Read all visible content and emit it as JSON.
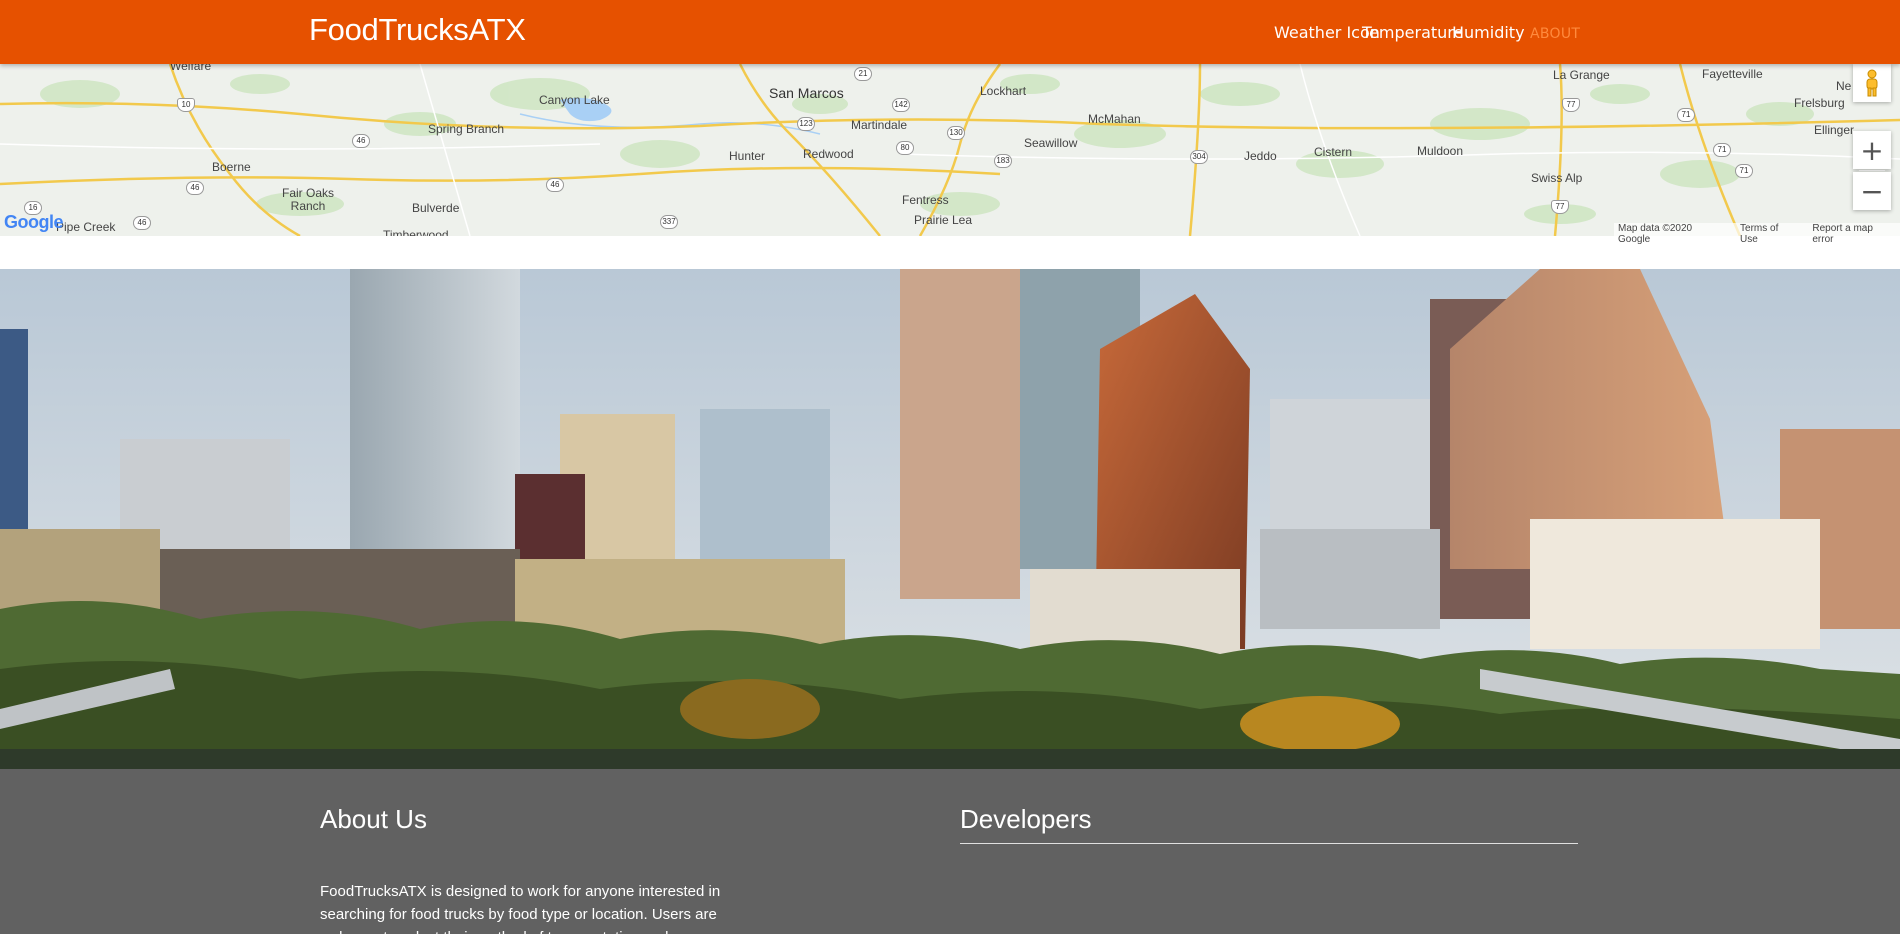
{
  "navbar": {
    "brand": "FoodTrucksATX",
    "weather_icon_alt": "Weather Icon",
    "temperature_label": "Temperature",
    "humidity_label": "Humidity",
    "about_link": "ABOUT"
  },
  "map": {
    "places": [
      "Welfare",
      "Canyon Lake",
      "San Marcos",
      "Lockhart",
      "La Grange",
      "Fayetteville",
      "Ne",
      "Frelsburg",
      "Spring Branch",
      "Martindale",
      "McMahan",
      "Boerne",
      "Hunter",
      "Redwood",
      "Seawillow",
      "Jeddo",
      "Cistern",
      "Muldoon",
      "Ellinger",
      "Fair Oaks Ranch",
      "Swiss Alp",
      "Bulverde",
      "Fentress",
      "Prairie Lea",
      "Pipe Creek",
      "Timberwood"
    ],
    "shields": [
      "21",
      "10",
      "142",
      "123",
      "130",
      "77",
      "71",
      "46",
      "80",
      "183",
      "304",
      "71",
      "46",
      "46",
      "71",
      "16",
      "46",
      "337",
      "77"
    ],
    "logo": "Google",
    "footer": {
      "map_data": "Map data ©2020 Google",
      "terms": "Terms of Use",
      "report": "Report a map error"
    },
    "zoom_in": "+",
    "zoom_out": "−"
  },
  "hero": {
    "scene": "Austin city skyline"
  },
  "footer": {
    "about_title": "About Us",
    "developers_title": "Developers",
    "about_text": "FoodTrucksATX is designed to work for anyone interested in searching for food trucks by food type or location. Users are welcome to select their method of transportation and"
  },
  "colors": {
    "navbar": "#e65100",
    "about_link": "#ff8a3d",
    "footer": "#616161"
  }
}
